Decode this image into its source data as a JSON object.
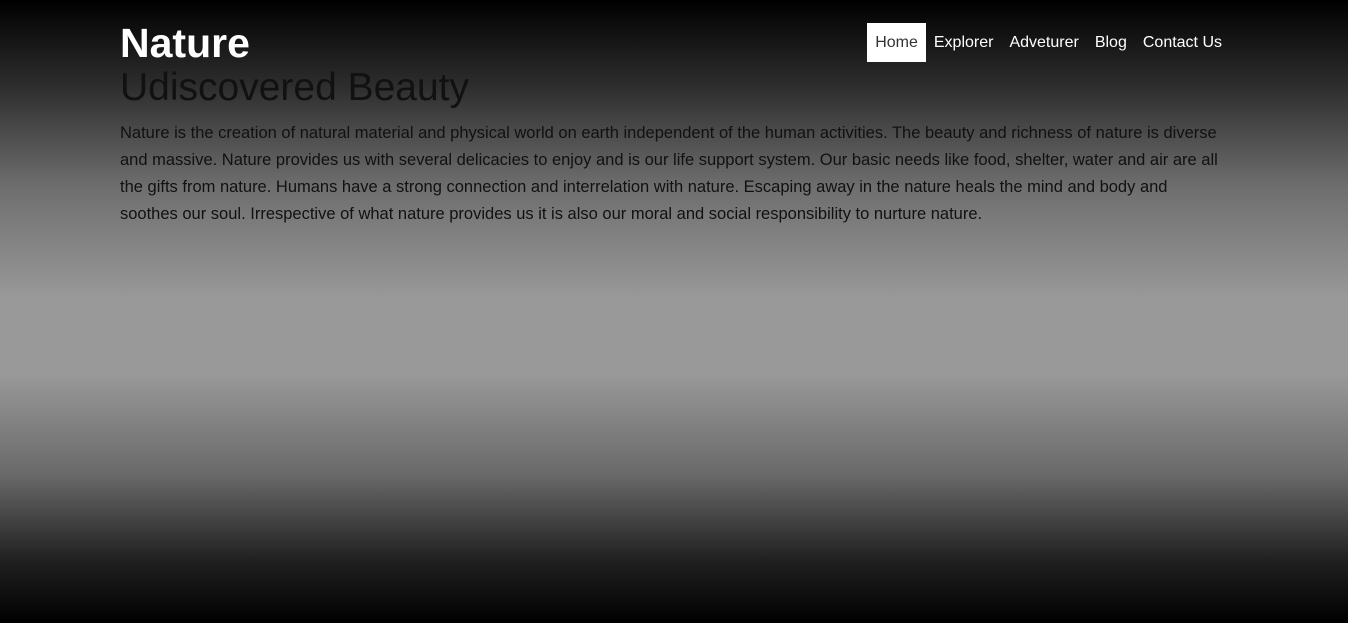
{
  "header": {
    "title": "Nature",
    "subtitle": "Udiscovered Beauty"
  },
  "nav": {
    "items": [
      {
        "label": "Home",
        "active": true
      },
      {
        "label": "Explorer",
        "active": false
      },
      {
        "label": "Adveturer",
        "active": false
      },
      {
        "label": "Blog",
        "active": false
      },
      {
        "label": "Contact Us",
        "active": false
      }
    ]
  },
  "main": {
    "paragraph": "Nature is the creation of natural material and physical world on earth independent of the human activities. The beauty and richness of nature is diverse and massive. Nature provides us with several delicacies to enjoy and is our life support system. Our basic needs like food, shelter, water and air are all the gifts from nature. Humans have a strong connection and interrelation with nature. Escaping away in the nature heals the mind and body and soothes our soul. Irrespective of what nature provides us it is also our moral and social responsibility to nurture nature."
  },
  "colors": {
    "active_nav_bg": "#ffffff",
    "active_nav_text": "#333333",
    "nav_text": "#ffffff",
    "title_text": "#ffffff",
    "body_text": "#111111"
  }
}
